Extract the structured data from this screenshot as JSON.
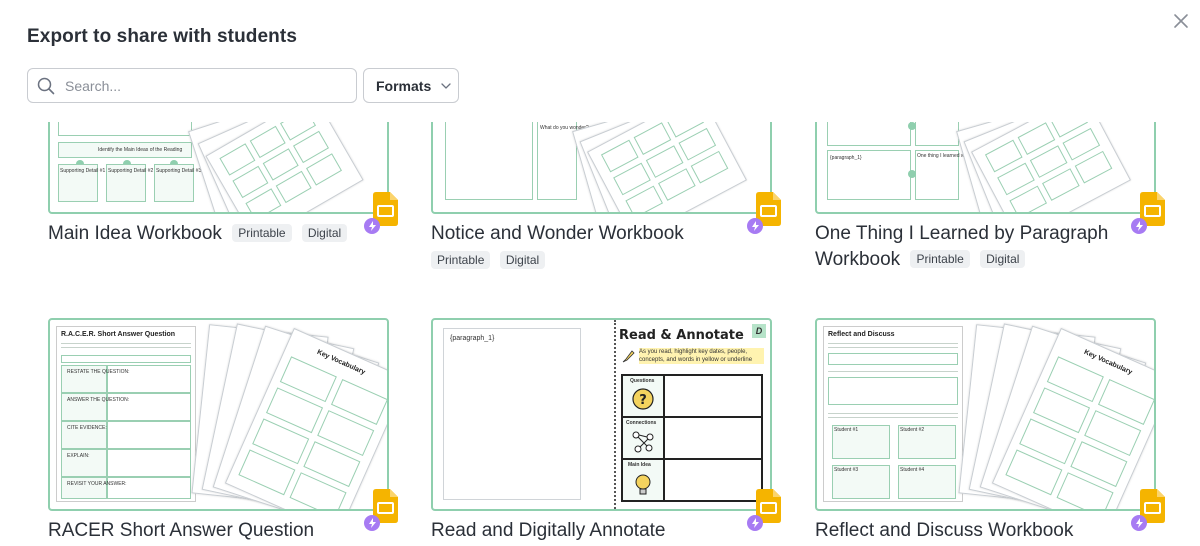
{
  "header": {
    "title": "Export to share with students",
    "close_label": "×"
  },
  "search": {
    "placeholder": "Search...",
    "value": ""
  },
  "formats": {
    "label": "Formats"
  },
  "cards": [
    {
      "title": "Main Idea Workbook",
      "tags": [
        "Printable",
        "Digital"
      ],
      "thumb_texts": [
        "Identify the Main Ideas of the Reading",
        "Supporting Detail #1",
        "Supporting Detail #2",
        "Supporting Detail #3"
      ]
    },
    {
      "title": "Notice and Wonder Workbook",
      "tags": [
        "Printable",
        "Digital"
      ],
      "thumb_texts": [
        "What do you wonder?"
      ]
    },
    {
      "title": "One Thing I Learned by Paragraph Workbook",
      "title_line1": "One Thing I Learned by Paragraph",
      "title_line2": "Workbook",
      "tags": [
        "Printable",
        "Digital"
      ],
      "thumb_texts": [
        "{paragraph_1}",
        "One thing I learned was..."
      ]
    },
    {
      "title": "RACER Short Answer Question",
      "tags": [],
      "thumb_texts": [
        "R.A.C.E.R. Short Answer Question",
        "RESTATE THE QUESTION:",
        "ANSWER THE QUESTION:",
        "CITE EVIDENCE:",
        "EXPLAIN:",
        "REVISIT YOUR ANSWER:",
        "Key Vocabulary"
      ]
    },
    {
      "title": "Read and Digitally Annotate",
      "tags": [],
      "thumb_texts": [
        "{paragraph_1}",
        "Read & Annotate",
        "D",
        "As you read, highlight key dates, people, concepts, and words in yellow or underline",
        "Questions",
        "Connections",
        "Main Idea"
      ]
    },
    {
      "title": "Reflect and Discuss Workbook",
      "tags": [],
      "thumb_texts": [
        "Reflect and Discuss",
        "Key Vocabulary",
        "Student #1",
        "Student #2",
        "Student #3",
        "Student #4"
      ]
    }
  ],
  "colors": {
    "accent_green": "#8fcfae",
    "slides_yellow": "#f5b400",
    "bolt_purple": "#a77bf3"
  }
}
